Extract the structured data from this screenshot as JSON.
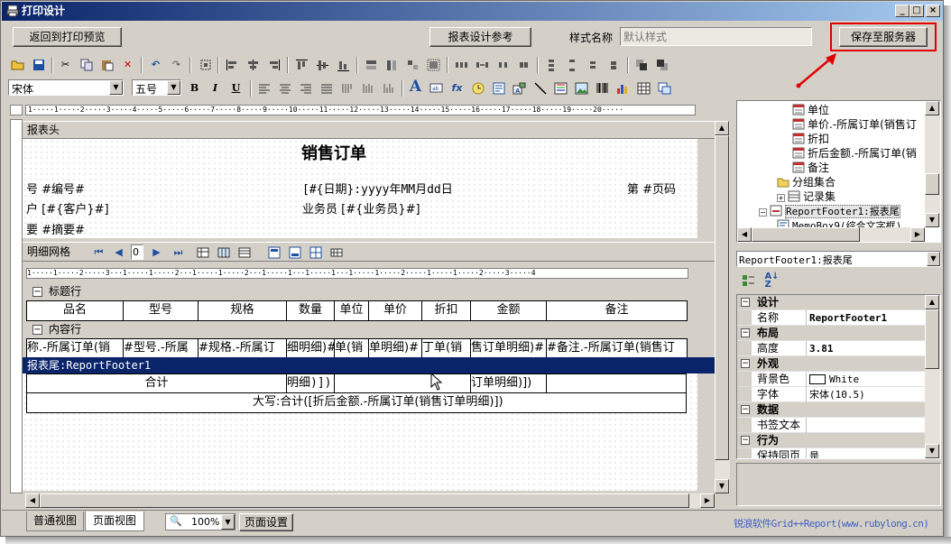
{
  "window": {
    "title": "打印设计"
  },
  "topbar": {
    "back_label": "返回到打印预览",
    "ref_label": "报表设计参考",
    "style_label": "样式名称",
    "style_placeholder": "默认样式",
    "save_label": "保存至服务器"
  },
  "format": {
    "font": "宋体",
    "size": "五号",
    "bold": "B",
    "italic": "I",
    "underline": "U"
  },
  "ruler": {
    "main": "1·····1·····2·····3·····4·····5·····6·····7·····8·····9·····10·····11·····12·····13·····14·····15·····16·····17·····18·····19·····20·····"
  },
  "header_band": {
    "label": "报表头",
    "title": "销售订单",
    "order_no": "号  #编号#",
    "date": "[#{日期}:yyyy年MM月dd日",
    "page": "第 #页码",
    "customer": "户  [#{客户}#]",
    "salesman": "业务员  [#{业务员}#]",
    "summary": "要 #摘要#"
  },
  "grid": {
    "label": "明细网格",
    "page_value": "0",
    "ruler": "1·····1·····2·····3···1·····1·····2···1·····1·····2···1·····1···1·····1···1·····1·····2·····1·····1·····2·····3·····4"
  },
  "title_row": {
    "label": "标题行",
    "columns": [
      "品名",
      "型号",
      "规格",
      "数量",
      "单位",
      "单价",
      "折扣",
      "金额",
      "备注"
    ]
  },
  "content_row": {
    "label": "内容行",
    "cells": [
      "称.-所属订单(销",
      "#型号.-所属",
      "#规格.-所属订",
      "细明细)#",
      "单(销",
      "单明细)#",
      "丁单(销",
      "售订单明细)#",
      "#备注.-所属订单(销售订"
    ]
  },
  "footer_band": {
    "label": "报表尾:ReportFooter1",
    "total_label": "合计",
    "total_qty": "明细)])",
    "total_amount": "订单明细)])",
    "caps": "大写:合计([折后金额.-所属订单(销售订单明细)])"
  },
  "tree": {
    "items": [
      "单位",
      "单价.-所属订单(销售订",
      "折扣",
      "折后金额.-所属订单(销",
      "备注",
      "分组集合",
      "记录集",
      "ReportFooter1:报表尾",
      "MemoBox9(综合文字框)"
    ]
  },
  "props": {
    "selector": "ReportFooter1:报表尾",
    "cats": [
      "设计",
      "布局",
      "外观",
      "数据",
      "行为"
    ],
    "name_k": "名称",
    "name_v": "ReportFooter1",
    "height_k": "高度",
    "height_v": "3.81",
    "bg_k": "背景色",
    "bg_v": "White",
    "font_k": "字体",
    "font_v": "宋体(10.5)",
    "book_k": "书签文本",
    "keep_k": "保持同页",
    "keep_v": "是"
  },
  "bottom": {
    "tab1": "普通视图",
    "tab2": "页面视图",
    "zoom": "100%",
    "page_setup": "页面设置",
    "brand": "锐浪软件Grid++Report(www.rubylong.cn)"
  },
  "colors": {
    "title_grad_start": "#0a246a",
    "title_grad_end": "#a6caf0",
    "selected_band": "#0a246a",
    "callout": "#e00000"
  }
}
